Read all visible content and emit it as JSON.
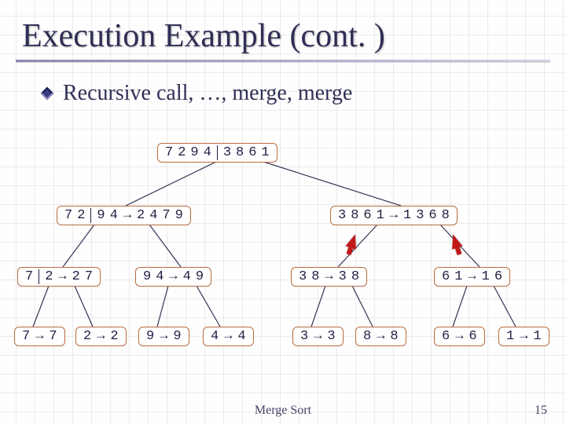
{
  "slide": {
    "title": "Execution Example (cont. )",
    "subtitle": "Recursive call, …, merge, merge",
    "footer": "Merge Sort",
    "page_number": "15"
  },
  "colors": {
    "node_border": "#b96c40",
    "title_text": "#2f2f55",
    "emphasis_arrow": "#c01818"
  },
  "tree": {
    "level0": {
      "left": [
        "7",
        "2",
        "9",
        "4"
      ],
      "right": [
        "3",
        "8",
        "6",
        "1"
      ]
    },
    "level1_left": {
      "in_left": [
        "7",
        "2"
      ],
      "in_right": [
        "9",
        "4"
      ],
      "out": [
        "2",
        "4",
        "7",
        "9"
      ]
    },
    "level1_right": {
      "in": [
        "3",
        "8",
        "6",
        "1"
      ],
      "out": [
        "1",
        "3",
        "6",
        "8"
      ]
    },
    "level2": [
      {
        "in_left": [
          "7"
        ],
        "in_right": [
          "2"
        ],
        "out": [
          "2",
          "7"
        ]
      },
      {
        "in": [
          "9",
          "4"
        ],
        "out": [
          "4",
          "9"
        ]
      },
      {
        "in": [
          "3",
          "8"
        ],
        "out": [
          "3",
          "8"
        ]
      },
      {
        "in": [
          "6",
          "1"
        ],
        "out": [
          "1",
          "6"
        ]
      }
    ],
    "level3": [
      {
        "in": [
          "7"
        ],
        "out": [
          "7"
        ]
      },
      {
        "in": [
          "2"
        ],
        "out": [
          "2"
        ]
      },
      {
        "in": [
          "9"
        ],
        "out": [
          "9"
        ]
      },
      {
        "in": [
          "4"
        ],
        "out": [
          "4"
        ]
      },
      {
        "in": [
          "3"
        ],
        "out": [
          "3"
        ]
      },
      {
        "in": [
          "8"
        ],
        "out": [
          "8"
        ]
      },
      {
        "in": [
          "6"
        ],
        "out": [
          "6"
        ]
      },
      {
        "in": [
          "1"
        ],
        "out": [
          "1"
        ]
      }
    ]
  },
  "emphasis_arrows": [
    {
      "from_level": 2,
      "index": 2,
      "to_level": 1,
      "side": "right"
    },
    {
      "from_level": 2,
      "index": 3,
      "to_level": 1,
      "side": "right"
    }
  ]
}
